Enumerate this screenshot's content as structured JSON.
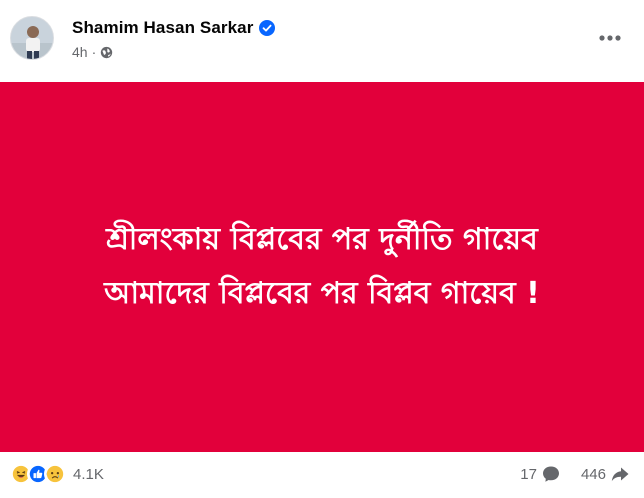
{
  "post": {
    "author": {
      "name": "Shamim Hasan Sarkar",
      "verified": true
    },
    "time": "4h",
    "separator": "·",
    "audience_icon": "globe-icon",
    "background_color": "#e2003b",
    "text_lines": [
      "শ্রীলংকায় বিপ্লবের পর দুর্নীতি গায়েব",
      "আমাদের বিপ্লবের পর বিপ্লব গায়েব !"
    ]
  },
  "footer": {
    "reactions": [
      "haha-icon",
      "like-icon",
      "sad-icon"
    ],
    "reaction_count": "4.1K",
    "comment_count": "17",
    "comment_icon": "comment-icon",
    "share_count": "446",
    "share_icon": "share-icon"
  },
  "colors": {
    "accent": "#0866ff",
    "muted_text": "#65676b",
    "post_background": "#e2003b"
  }
}
